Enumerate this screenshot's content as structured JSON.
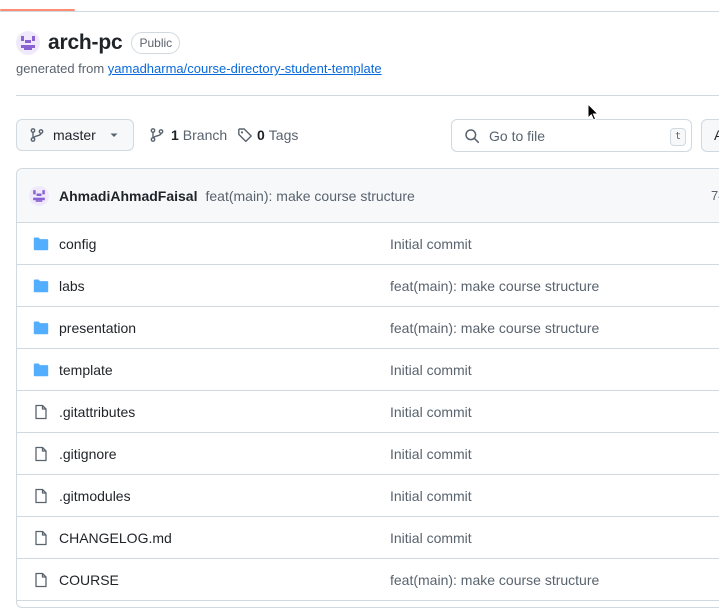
{
  "repo": {
    "name": "arch-pc",
    "visibility": "Public",
    "generated_prefix": "generated from ",
    "template_link": "yamadharma/course-directory-student-template"
  },
  "toolbar": {
    "branch_name": "master",
    "branch_count": "1",
    "branch_label": "Branch",
    "tag_count": "0",
    "tag_label": "Tags",
    "goto_placeholder": "Go to file",
    "goto_shortcut": "t",
    "add_label": "A"
  },
  "latest_commit": {
    "author": "AhmadiAhmadFaisal",
    "message": "feat(main): make course structure",
    "hash_partial": "74"
  },
  "files": [
    {
      "type": "folder",
      "name": "config",
      "commit": "Initial commit"
    },
    {
      "type": "folder",
      "name": "labs",
      "commit": "feat(main): make course structure"
    },
    {
      "type": "folder",
      "name": "presentation",
      "commit": "feat(main): make course structure"
    },
    {
      "type": "folder",
      "name": "template",
      "commit": "Initial commit"
    },
    {
      "type": "file",
      "name": ".gitattributes",
      "commit": "Initial commit"
    },
    {
      "type": "file",
      "name": ".gitignore",
      "commit": "Initial commit"
    },
    {
      "type": "file",
      "name": ".gitmodules",
      "commit": "Initial commit"
    },
    {
      "type": "file",
      "name": "CHANGELOG.md",
      "commit": "Initial commit"
    },
    {
      "type": "file",
      "name": "COURSE",
      "commit": "feat(main): make course structure"
    }
  ],
  "colors": {
    "folder": "#54aeff",
    "file": "#59636e",
    "link": "#0969da",
    "avatar": "#8a63d2"
  }
}
